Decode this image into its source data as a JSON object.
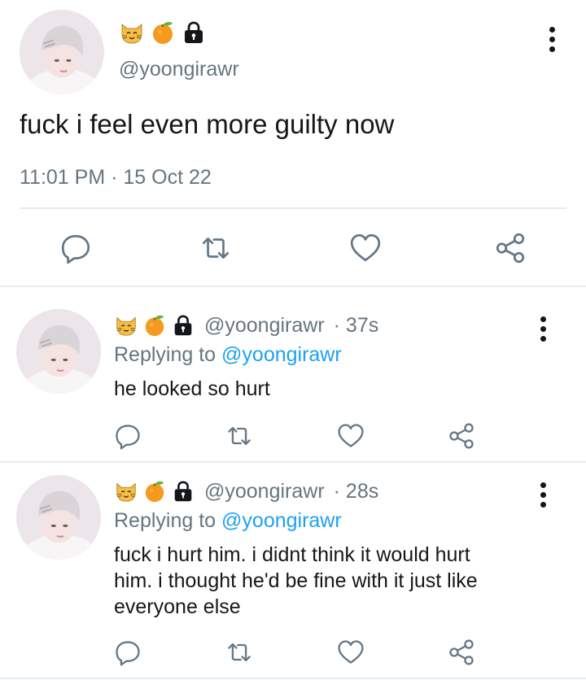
{
  "main_tweet": {
    "handle": "@yoongirawr",
    "text": "fuck i feel even more guilty now",
    "timestamp": "11:01 PM · 15 Oct 22",
    "name_icons": [
      "cat-face-icon",
      "tangerine-icon",
      "lock-icon"
    ],
    "actions": [
      "reply-icon",
      "retweet-icon",
      "like-icon",
      "share-icon"
    ]
  },
  "replies": [
    {
      "handle": "@yoongirawr",
      "time": "· 37s",
      "replying_to_prefix": "Replying to",
      "replying_to_handle": "@yoongirawr",
      "text": "he looked so hurt"
    },
    {
      "handle": "@yoongirawr",
      "time": "· 28s",
      "replying_to_prefix": "Replying to",
      "replying_to_handle": "@yoongirawr",
      "text_lines": [
        "fuck i hurt him. i didnt think it would hurt",
        "him. i thought he'd be fine with it just like",
        "everyone else"
      ]
    }
  ],
  "colors": {
    "icon_gray": "#657786",
    "link_blue": "#1da1f2",
    "divider": "#e6ecf0"
  }
}
